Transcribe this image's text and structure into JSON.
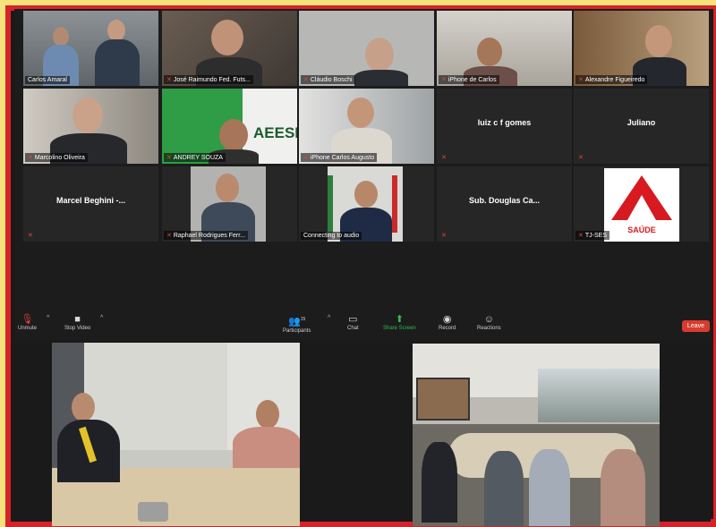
{
  "participants": [
    {
      "name": "Carlos Amaral",
      "active": true
    },
    {
      "name": "José Raimundo Fed. Futs...",
      "active": false
    },
    {
      "name": "Cláudio Boschi",
      "active": false
    },
    {
      "name": "iPhone de Carlos",
      "active": false
    },
    {
      "name": "Alexandre Figueiredo",
      "active": false
    },
    {
      "name": "Marcolino Oliveira",
      "active": false
    },
    {
      "name": "ANDREY SOUZA",
      "active": false
    },
    {
      "name": "iPhone Carlos Augusto",
      "active": false
    },
    {
      "name": "",
      "display_name": "luiz c f gomes",
      "active": false
    },
    {
      "name": "",
      "display_name": "Juliano",
      "active": false
    },
    {
      "name": "",
      "display_name": "Marcel Beghini -...",
      "active": false
    },
    {
      "name": "Raphael Rodrigues Ferr...",
      "active": false
    },
    {
      "name": "Connecting to audio",
      "active": false
    },
    {
      "name": "",
      "display_name": "Sub. Douglas Ca...",
      "active": false
    },
    {
      "name": "TJ-SES",
      "active": false
    }
  ],
  "tile_texts": {
    "aeesb": "AEESB",
    "saude": "SAÚDE"
  },
  "toolbar": {
    "unmute": "Unmute",
    "stop_video": "Stop Video",
    "participants": "Participants",
    "participants_count": "15",
    "chat": "Chat",
    "share_screen": "Share Screen",
    "record": "Record",
    "reactions": "Reactions",
    "leave": "Leave"
  },
  "colors": {
    "frame_yellow": "#f6e27a",
    "frame_red": "#d8222a",
    "active_speaker": "#f0e24a",
    "share_green": "#2fbf4b",
    "leave_red": "#d83b2f"
  }
}
